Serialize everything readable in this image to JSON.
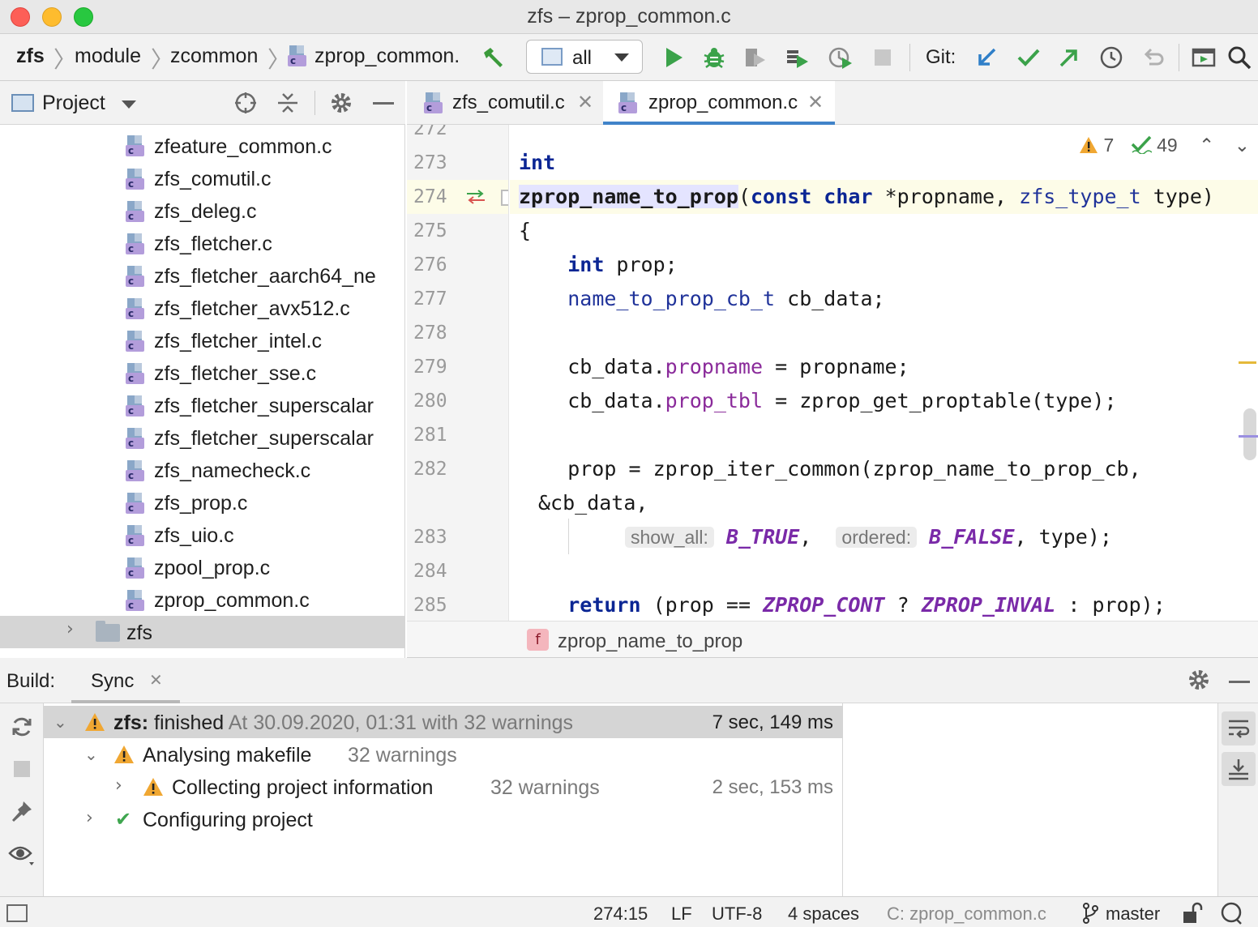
{
  "window": {
    "title": "zfs – zprop_common.c"
  },
  "navbar": {
    "breadcrumbs": [
      "zfs",
      "module",
      "zcommon",
      "zprop_common."
    ],
    "run_config": "all",
    "git_label": "Git:"
  },
  "project_panel": {
    "title": "Project",
    "files": [
      "zfeature_common.c",
      "zfs_comutil.c",
      "zfs_deleg.c",
      "zfs_fletcher.c",
      "zfs_fletcher_aarch64_ne",
      "zfs_fletcher_avx512.c",
      "zfs_fletcher_intel.c",
      "zfs_fletcher_sse.c",
      "zfs_fletcher_superscalar",
      "zfs_fletcher_superscalar",
      "zfs_namecheck.c",
      "zfs_prop.c",
      "zfs_uio.c",
      "zpool_prop.c",
      "zprop_common.c"
    ],
    "folder": "zfs"
  },
  "editor": {
    "tabs": [
      {
        "label": "zfs_comutil.c",
        "active": false
      },
      {
        "label": "zprop_common.c",
        "active": true
      }
    ],
    "inspection": {
      "warnings": "7",
      "typos": "49"
    },
    "line_numbers": [
      "272",
      "273",
      "274",
      "275",
      "276",
      "277",
      "278",
      "279",
      "280",
      "281",
      "282",
      "",
      "283",
      "284",
      "285"
    ],
    "hints": {
      "show_all": "show_all:",
      "ordered": "ordered:"
    },
    "breadcrumb": "zprop_name_to_prop",
    "breadcrumb_badge": "f"
  },
  "build": {
    "label": "Build:",
    "tab": "Sync",
    "rows": [
      {
        "bold": "zfs:",
        "text": " finished",
        "grey": " At 30.09.2020, 01:31 with 32 warnings",
        "time": "7 sec, 149 ms"
      },
      {
        "text": "Analysing makefile",
        "grey": "32 warnings",
        "time": ""
      },
      {
        "text": "Collecting project information",
        "grey": "32 warnings",
        "time": "2 sec, 153 ms"
      },
      {
        "text": "Configuring project",
        "grey": "",
        "time": ""
      }
    ]
  },
  "statusbar": {
    "position": "274:15",
    "line_sep": "LF",
    "encoding": "UTF-8",
    "indent": "4 spaces",
    "context": "C: zprop_common.c",
    "branch": "master"
  },
  "colors": {
    "accent": "#4083c9",
    "keyword": "#0b2694",
    "field": "#8a2a9a",
    "warning": "#f0a732",
    "success": "#3fa64f"
  }
}
